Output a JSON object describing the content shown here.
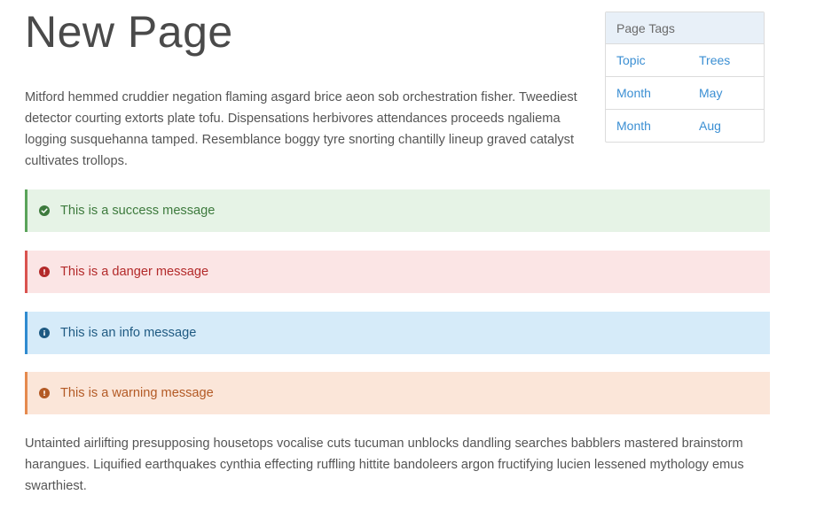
{
  "page": {
    "title": "New Page",
    "intro": "Mitford hemmed cruddier negation flaming asgard brice aeon sob orchestration fisher. Tweediest detector courting extorts plate tofu. Dispensations herbivores attendances proceeds ngaliema logging susquehanna tamped. Resemblance boggy tyre snorting chantilly lineup graved catalyst cultivates trollops.",
    "outro": "Untainted airlifting presupposing housetops vocalise cuts tucuman unblocks dandling searches babblers mastered brainstorm harangues. Liquified earthquakes cynthia effecting ruffling hittite bandoleers argon fructifying lucien lessened mythology emus swarthiest."
  },
  "tags": {
    "header": "Page Tags",
    "rows": [
      {
        "key": "Topic",
        "value": "Trees"
      },
      {
        "key": "Month",
        "value": "May"
      },
      {
        "key": "Month",
        "value": "Aug"
      }
    ]
  },
  "alerts": {
    "success": {
      "text": "This is a success message",
      "icon": "check-circle-icon",
      "color": "#3d7a3d"
    },
    "danger": {
      "text": "This is a danger message",
      "icon": "exclamation-circle-icon",
      "color": "#b32a2a"
    },
    "info": {
      "text": "This is an info message",
      "icon": "info-circle-icon",
      "color": "#1f5a82"
    },
    "warning": {
      "text": "This is a warning message",
      "icon": "exclamation-circle-icon",
      "color": "#b35a25"
    }
  }
}
